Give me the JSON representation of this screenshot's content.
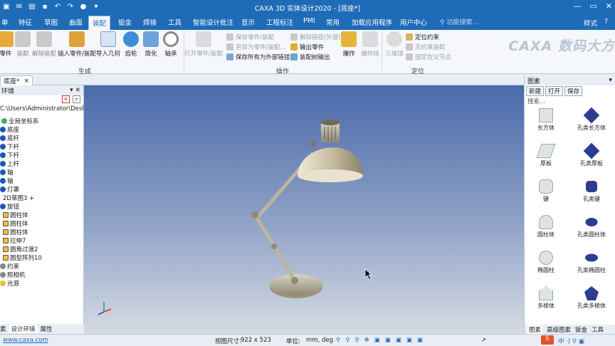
{
  "window": {
    "title": "CAXA 3D 实体设计2020 - [底座*]"
  },
  "menu_tabs": [
    "单",
    "特征",
    "草图",
    "曲面",
    "装配",
    "钣金",
    "焊接",
    "工具",
    "智能设计批注",
    "显示",
    "工程标注",
    "PMI",
    "常用",
    "加载应用程序",
    "用户中心"
  ],
  "active_tab": "装配",
  "search_placeholder": "功能搜索...",
  "menu_right": {
    "style": "样式",
    "help": "?"
  },
  "ribbon": {
    "shengcheng": {
      "label": "生成",
      "buttons": [
        "零件",
        "装配",
        "解除装配",
        "插入零件/装配",
        "导入几何",
        "齿轮",
        "简化",
        "轴承"
      ]
    },
    "caozuo": {
      "label": "操作",
      "open_button": "打开零件/装配",
      "small_col1": [
        "保存零件/装配",
        "另存为零件/装配...",
        "保存所有为外部链接"
      ],
      "small_col2": [
        "解除链接(外部)",
        "输出零件",
        "装配树输出"
      ],
      "buttons": [
        "爆炸",
        "爆炸线"
      ]
    },
    "dingwei": {
      "label": "定位",
      "button": "三维球",
      "small": [
        "定位约束",
        "无约束装配",
        "固定在父节点"
      ]
    },
    "logo": "CAXA 数码大方"
  },
  "doc_tab": {
    "label": "底座*",
    "close": "×"
  },
  "left_panel": {
    "header": "环境",
    "path": "C:\\Users\\Administrator\\Desktop",
    "tree": [
      "全局坐标系",
      "底座",
      "底杆",
      "下杆",
      "下杆",
      "上杆",
      "轴",
      "轴",
      "灯罩",
      "2D草图3 +",
      "旋钮",
      "圆柱体",
      "圆柱体",
      "圆柱体",
      "拉伸7",
      "圆角过渡2",
      "圆型阵列10",
      "约束",
      "照相机",
      "光源"
    ],
    "tabs": [
      "素",
      "设计环境",
      "属性"
    ]
  },
  "right_panel": {
    "header": "图素",
    "buttons": [
      "新建",
      "打开",
      "保存"
    ],
    "search": "搜索...",
    "shapes": [
      "长方体",
      "孔类长方体",
      "厚板",
      "孔类厚板",
      "键",
      "孔类键",
      "圆柱体",
      "孔类圆柱体",
      "椭圆柱",
      "孔类椭圆柱",
      "多棱体",
      "孔类多棱体"
    ],
    "tabs": [
      "图素",
      "高级图素",
      "钣金",
      "工具"
    ]
  },
  "status": {
    "url": "www.caxa.com",
    "view_size_label": "视图尺寸:",
    "view_size": "922 x 523",
    "unit_label": "单位:",
    "unit": "mm, deg"
  },
  "colors": {
    "brand_blue": "#1e6bb8",
    "viewport_top": "#4a6aab",
    "viewport_bottom": "#d6dbe3"
  }
}
